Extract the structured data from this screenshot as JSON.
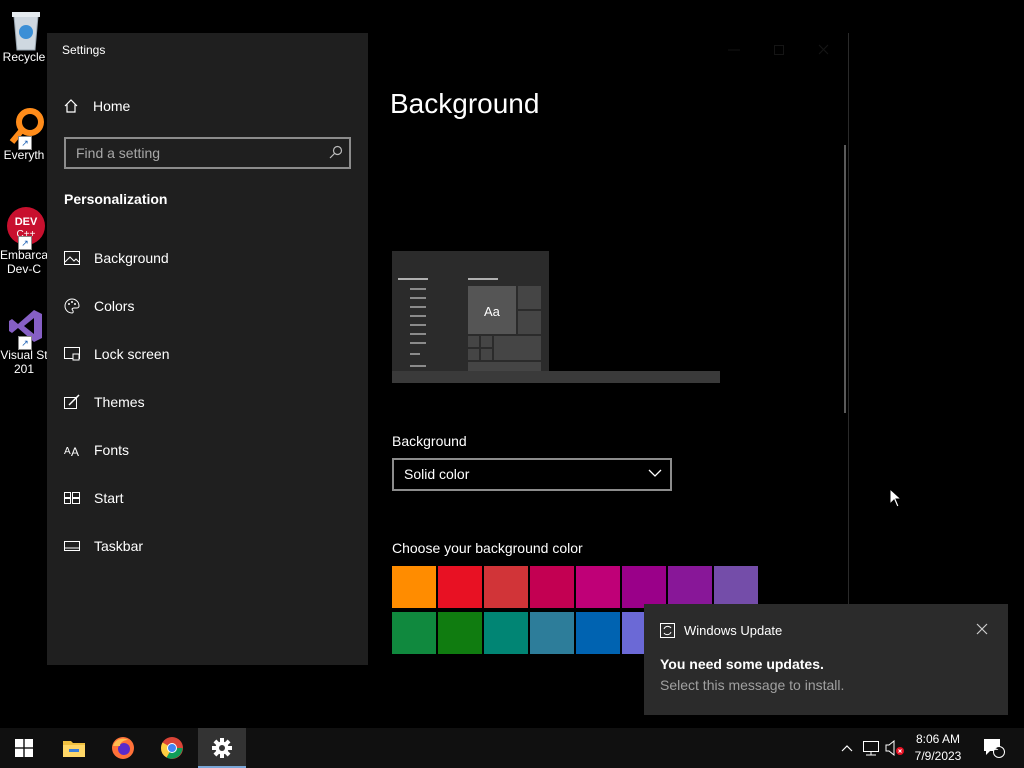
{
  "desktop": {
    "icons": [
      {
        "label": "Recycle",
        "icon": "recycle-bin-icon"
      },
      {
        "label": "Everyth",
        "icon": "everything-icon"
      },
      {
        "label": "Embarca",
        "label2": "Dev-C",
        "icon": "devcpp-icon"
      },
      {
        "label": "Visual St",
        "label2": "201",
        "icon": "visual-studio-icon"
      }
    ]
  },
  "settings": {
    "window_title": "Settings",
    "nav": {
      "home_label": "Home",
      "search_placeholder": "Find a setting",
      "section_title": "Personalization",
      "items": [
        {
          "label": "Background",
          "icon": "picture-icon"
        },
        {
          "label": "Colors",
          "icon": "palette-icon"
        },
        {
          "label": "Lock screen",
          "icon": "lock-screen-icon"
        },
        {
          "label": "Themes",
          "icon": "themes-icon"
        },
        {
          "label": "Fonts",
          "icon": "fonts-icon"
        },
        {
          "label": "Start",
          "icon": "start-icon"
        },
        {
          "label": "Taskbar",
          "icon": "taskbar-icon"
        }
      ]
    },
    "content": {
      "page_title": "Background",
      "preview_text": "Aa",
      "background_label": "Background",
      "background_value": "Solid color",
      "color_label": "Choose your background color",
      "swatch_colors": [
        [
          "#ff8c00",
          "#e81123",
          "#d13438",
          "#c30052",
          "#bf0077",
          "#9a0089",
          "#881798",
          "#744da9"
        ],
        [
          "#10893e",
          "#107c10",
          "#018574",
          "#2d7d9a",
          "#0063b1",
          "#6b69d6"
        ]
      ]
    }
  },
  "notification": {
    "app": "Windows Update",
    "headline": "You need some updates.",
    "body": "Select this message to install."
  },
  "taskbar": {
    "apps": [
      "start-icon",
      "file-explorer-icon",
      "firefox-icon",
      "chrome-icon",
      "settings-icon"
    ],
    "time": "8:06 AM",
    "date": "7/9/2023",
    "notification_count": "1"
  }
}
